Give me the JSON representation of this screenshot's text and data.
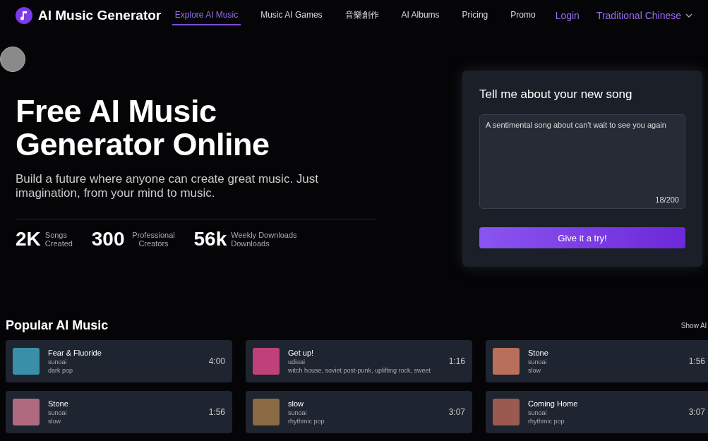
{
  "brand": {
    "name": "AI Music Generator"
  },
  "nav": [
    {
      "label": "Explore AI Music",
      "selected": true
    },
    {
      "label": "Music AI Games",
      "selected": false
    },
    {
      "label": "音樂創作",
      "selected": false
    },
    {
      "label": "AI Albums",
      "selected": false
    },
    {
      "label": "Pricing",
      "selected": false
    },
    {
      "label": "Promo",
      "selected": false
    }
  ],
  "login": "Login",
  "language": "Traditional Chinese",
  "hero": {
    "title": "Free AI Music Generator Online",
    "subtitle": "Build a future where anyone can create great music. Just imagination, from your mind to music.",
    "stats": [
      {
        "value": "2K",
        "label": "Songs Created"
      },
      {
        "value": "300",
        "label": "Professional Creators"
      },
      {
        "value": "56k",
        "label": "Weekly Downloads Downloads"
      }
    ]
  },
  "composer": {
    "title": "Tell me about your new song",
    "value": "A sentimental song about can't wait to see you again",
    "counter": "18/200",
    "button": "Give it a try!"
  },
  "popular": {
    "title": "Popular AI Music",
    "show_all": "Show Al",
    "songs": [
      {
        "title": "Fear & Fluoride",
        "artist": "sunoai",
        "genre": "dark pop",
        "duration": "4:00",
        "color": "#3a8fa8"
      },
      {
        "title": "Get up!",
        "artist": "udioai",
        "genre": "witch house, soviet post-punk, uplifting rock, sweet",
        "duration": "1:16",
        "color": "#c0407a"
      },
      {
        "title": "Stone",
        "artist": "sunoai",
        "genre": "slow",
        "duration": "1:56",
        "color": "#b8705a"
      },
      {
        "title": "Stone",
        "artist": "sunoai",
        "genre": "slow",
        "duration": "1:56",
        "color": "#b06a80"
      },
      {
        "title": "slow",
        "artist": "sunoai",
        "genre": "rhythmic pop",
        "duration": "3:07",
        "color": "#8a6a40"
      },
      {
        "title": "Coming Home",
        "artist": "sunoai",
        "genre": "rhythmic pop",
        "duration": "3:07",
        "color": "#9a5a50"
      }
    ]
  }
}
